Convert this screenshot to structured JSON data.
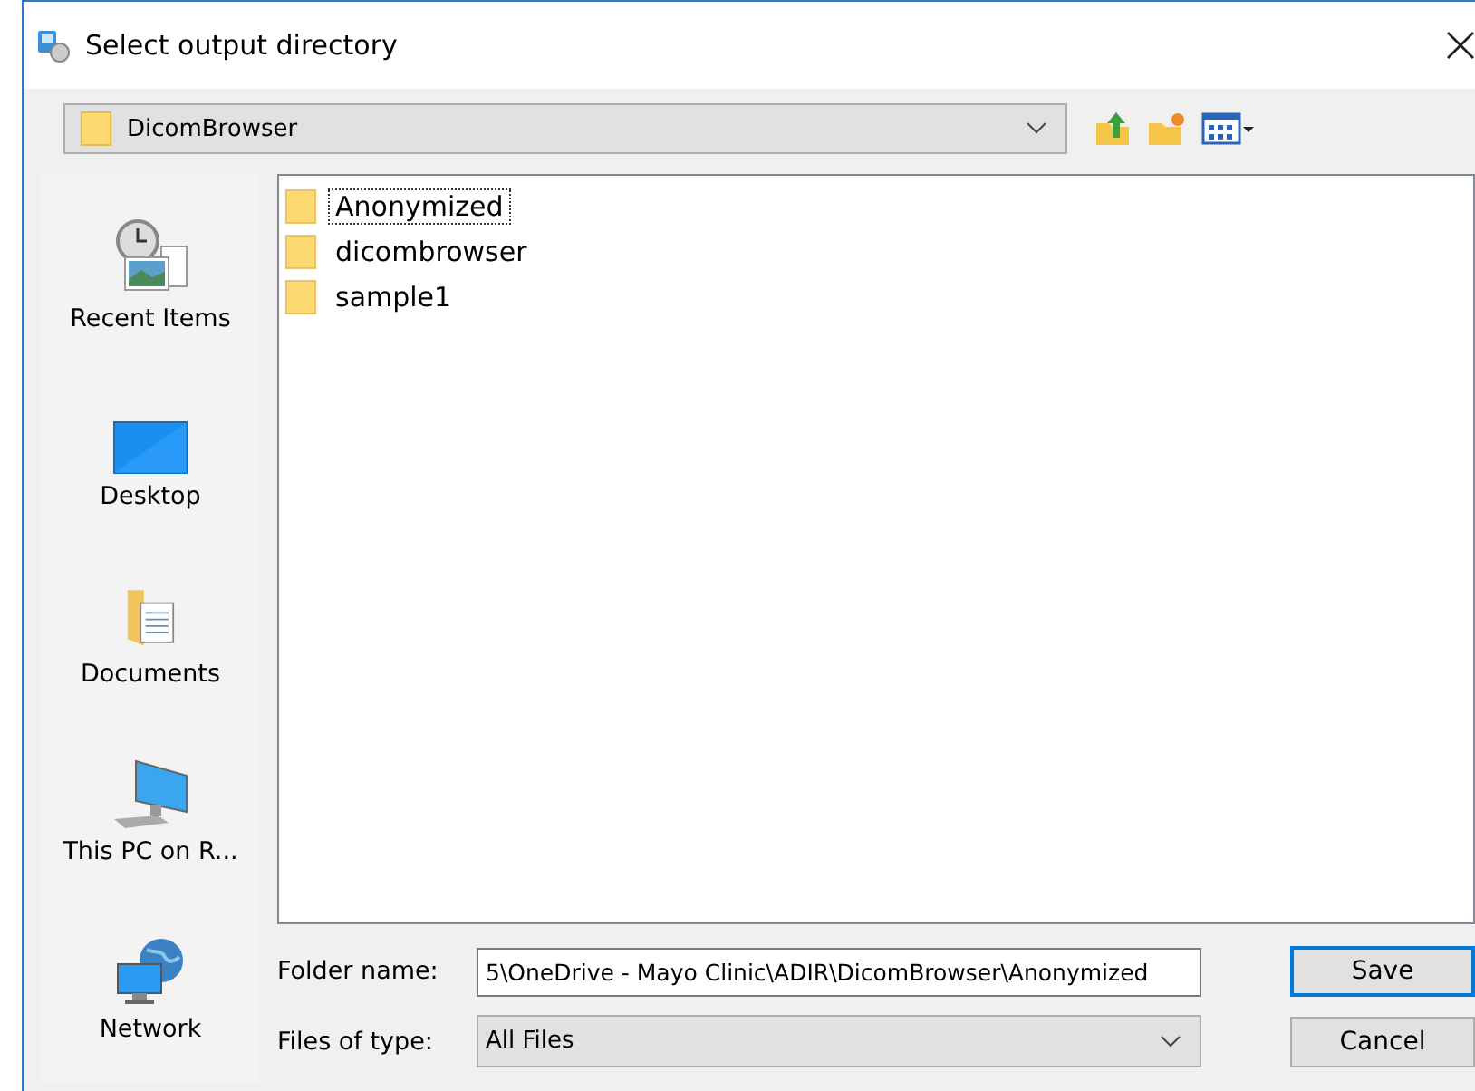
{
  "window": {
    "title": "Select output directory"
  },
  "look_in": {
    "value": "DicomBrowser"
  },
  "places": [
    {
      "kind": "recent",
      "label": "Recent Items"
    },
    {
      "kind": "desktop",
      "label": "Desktop"
    },
    {
      "kind": "documents",
      "label": "Documents"
    },
    {
      "kind": "computer",
      "label": "This PC on R..."
    },
    {
      "kind": "network",
      "label": "Network"
    }
  ],
  "files": [
    {
      "name": "Anonymized",
      "selected": true
    },
    {
      "name": "dicombrowser",
      "selected": false
    },
    {
      "name": "sample1",
      "selected": false
    }
  ],
  "folder_name": {
    "label": "Folder name:",
    "value": "5\\OneDrive - Mayo Clinic\\ADIR\\DicomBrowser\\Anonymized"
  },
  "files_of_type": {
    "label": "Files of type:",
    "value": "All Files"
  },
  "buttons": [
    {
      "label": "Save",
      "default": true
    },
    {
      "label": "Cancel",
      "default": false
    }
  ]
}
